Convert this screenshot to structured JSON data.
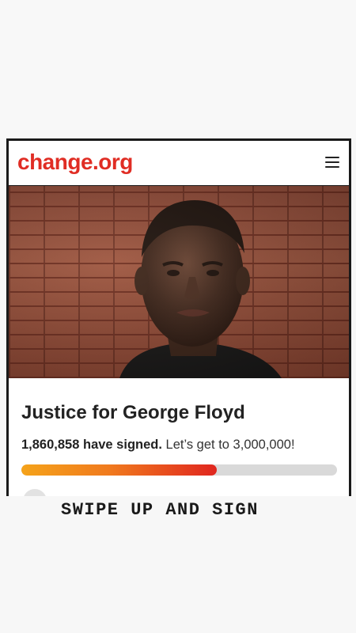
{
  "header": {
    "logo_text": "change.org",
    "menu_icon": "hamburger-menu-icon",
    "brand_color": "#e02d24"
  },
  "petition": {
    "title": "Justice for George Floyd",
    "signed_count": "1,860,858 have signed.",
    "goal_text": "Let’s get to 3,000,000!",
    "progress": 0.62,
    "progress_colors": [
      "#f5a31a",
      "#e0261f"
    ]
  },
  "story": {
    "caption": "SWIPE UP AND SIGN"
  }
}
